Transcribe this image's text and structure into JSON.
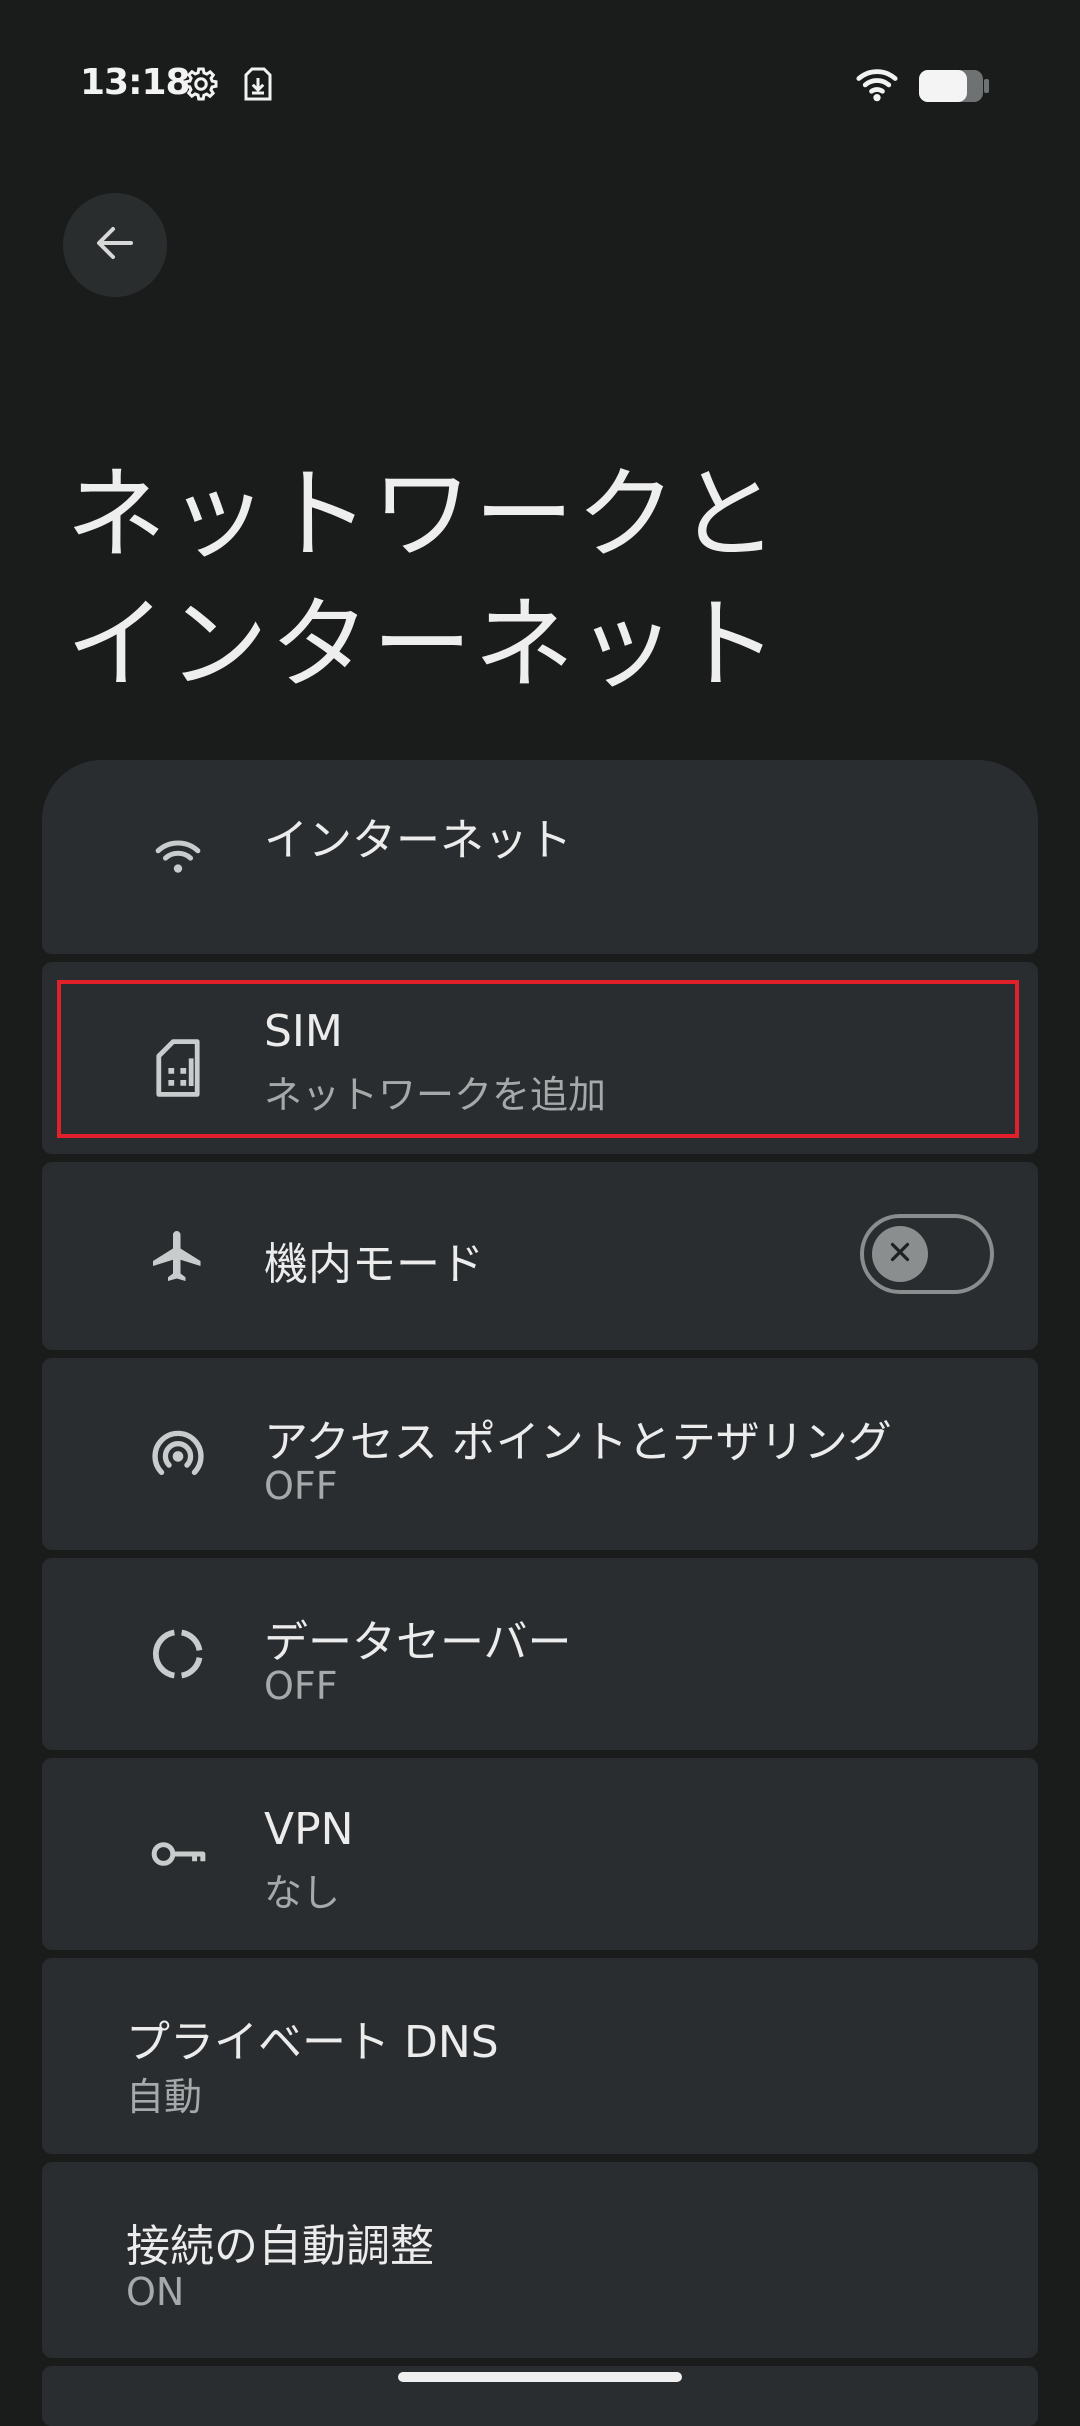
{
  "status_bar": {
    "time": "13:18",
    "icons_left": [
      "gear-icon",
      "download-icon"
    ],
    "icons_right": [
      "wifi-icon",
      "battery-icon"
    ]
  },
  "header": {
    "back_icon": "arrow-back-icon",
    "title_line1": "ネットワークと",
    "title_line2": "インターネット"
  },
  "items": [
    {
      "icon": "wifi-icon",
      "title": "インターネット",
      "subtitle": ""
    },
    {
      "icon": "sim-card-icon",
      "title": "SIM",
      "subtitle": "ネットワークを追加"
    },
    {
      "icon": "airplane-icon",
      "title": "機内モード",
      "subtitle": "",
      "toggle": "off"
    },
    {
      "icon": "hotspot-icon",
      "title": "アクセス ポイントとテザリング",
      "subtitle": "OFF"
    },
    {
      "icon": "data-saver-icon",
      "title": "データセーバー",
      "subtitle": "OFF"
    },
    {
      "icon": "vpn-key-icon",
      "title": "VPN",
      "subtitle": "なし"
    },
    {
      "icon": "",
      "title": "プライベート DNS",
      "subtitle": "自動"
    },
    {
      "icon": "",
      "title": "接続の自動調整",
      "subtitle": "ON"
    }
  ],
  "colors": {
    "background": "#1a1c1c",
    "card": "#2a2d2f",
    "highlight": "#e0202a"
  }
}
